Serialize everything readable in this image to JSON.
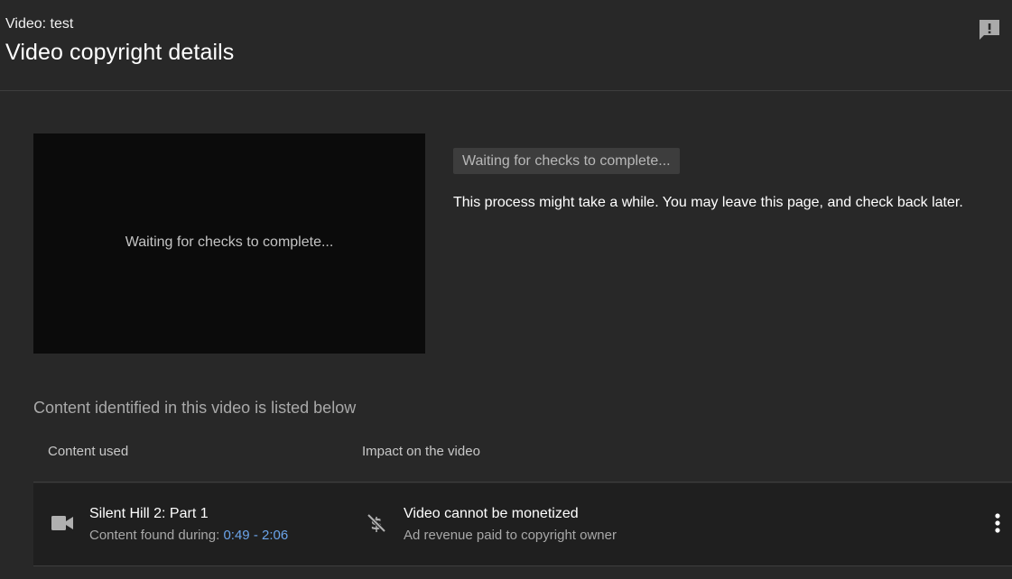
{
  "header": {
    "video_label": "Video: test",
    "title": "Video copyright details",
    "feedback_icon": "feedback-icon"
  },
  "preview": {
    "status_text": "Waiting for checks to complete..."
  },
  "status": {
    "chip_label": "Waiting for checks to complete...",
    "description": "This process might take a while. You may leave this page, and check back later."
  },
  "content_section": {
    "heading": "Content identified in this video is listed below",
    "columns": {
      "content_used": "Content used",
      "impact": "Impact on the video"
    },
    "rows": [
      {
        "content_icon": "video-camera-icon",
        "title": "Silent Hill 2: Part 1",
        "found_prefix": "Content found during: ",
        "timestamp": "0:49 - 2:06",
        "impact_icon": "no-monetization-icon",
        "impact_title": "Video cannot be monetized",
        "impact_subtitle": "Ad revenue paid to copyright owner",
        "menu_icon": "more-vert-icon"
      }
    ]
  },
  "colors": {
    "background": "#282828",
    "row_background": "#1f1f1f",
    "preview_background": "#0b0b0b",
    "link": "#6ba4ea"
  }
}
